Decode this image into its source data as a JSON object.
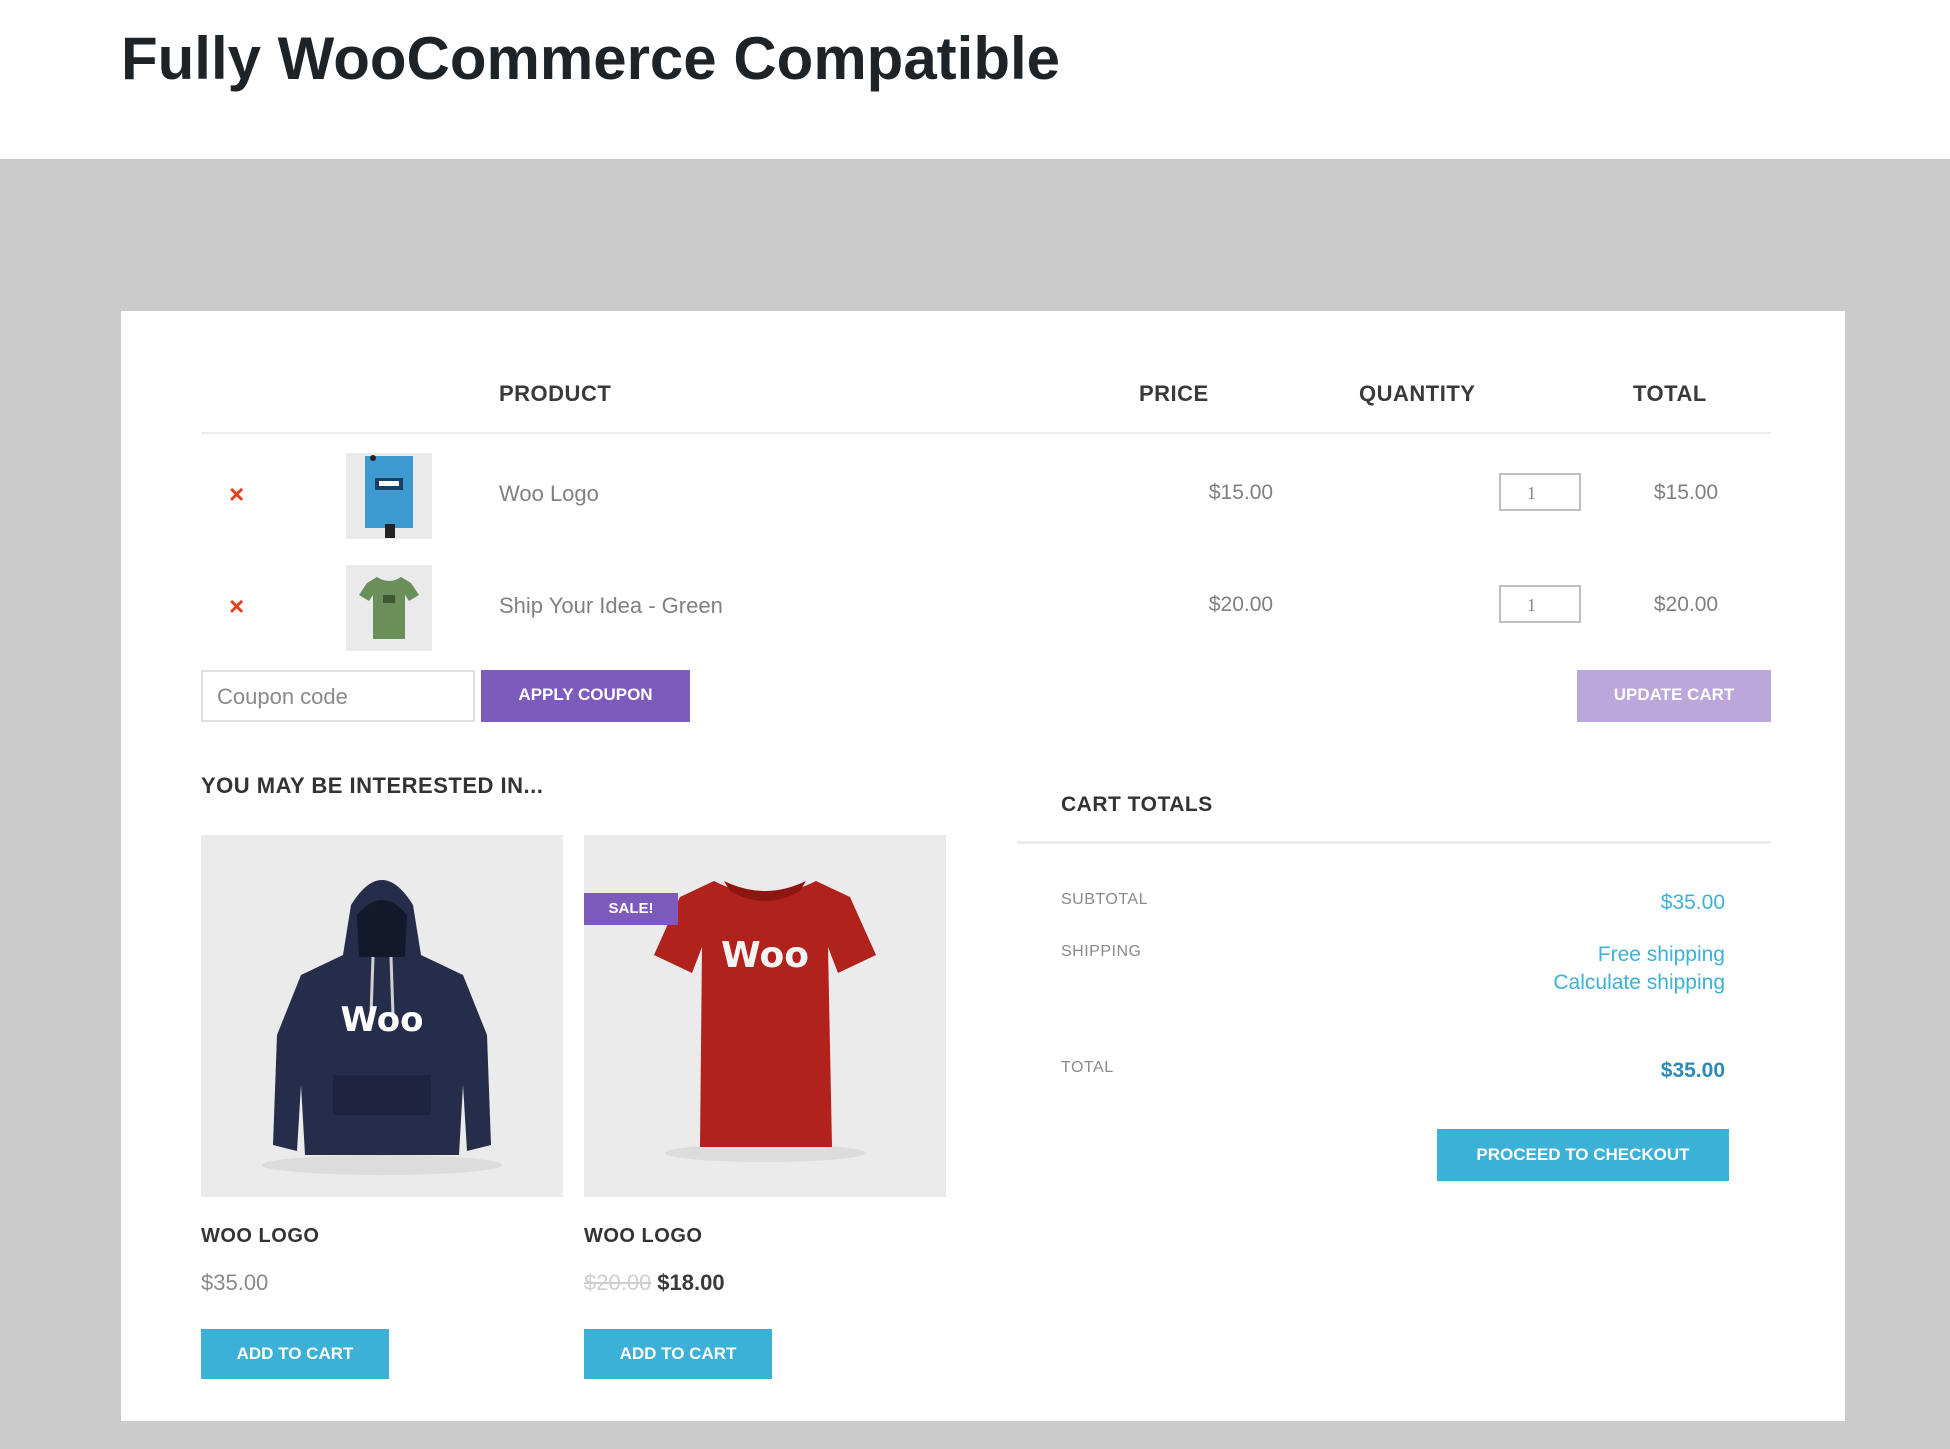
{
  "page_title": "Fully WooCommerce Compatible",
  "cart": {
    "columns": {
      "product": "PRODUCT",
      "price": "PRICE",
      "quantity": "QUANTITY",
      "total": "TOTAL"
    },
    "items": [
      {
        "remove": "×",
        "name": "Woo Logo",
        "price": "$15.00",
        "qty": "1",
        "total": "$15.00",
        "thumb": "poster-icon"
      },
      {
        "remove": "×",
        "name": "Ship Your Idea - Green",
        "price": "$20.00",
        "qty": "1",
        "total": "$20.00",
        "thumb": "green-tshirt-icon"
      }
    ],
    "coupon_placeholder": "Coupon code",
    "apply_coupon": "APPLY COUPON",
    "update_cart": "UPDATE CART"
  },
  "interested": {
    "title": "YOU MAY BE INTERESTED IN...",
    "products": [
      {
        "name": "WOO LOGO",
        "price": "$35.00",
        "button": "ADD TO CART",
        "image": "navy-hoodie",
        "logo_text": "Woo"
      },
      {
        "name": "WOO LOGO",
        "old_price": "$20.00",
        "price": "$18.00",
        "button": "ADD TO CART",
        "badge": "SALE!",
        "image": "red-tshirt",
        "logo_text": "Woo"
      }
    ]
  },
  "totals": {
    "title": "CART TOTALS",
    "subtotal_label": "SUBTOTAL",
    "subtotal_value": "$35.00",
    "shipping_label": "SHIPPING",
    "shipping_value": "Free shipping",
    "shipping_link": "Calculate shipping",
    "total_label": "TOTAL",
    "total_value": "$35.00",
    "checkout": "PROCEED TO CHECKOUT"
  },
  "colors": {
    "purple": "#7d5bbd",
    "light_purple": "#bba7dc",
    "blue": "#3cb1d7",
    "remove_red": "#e2401c",
    "gray_band": "#cbcbcb"
  }
}
